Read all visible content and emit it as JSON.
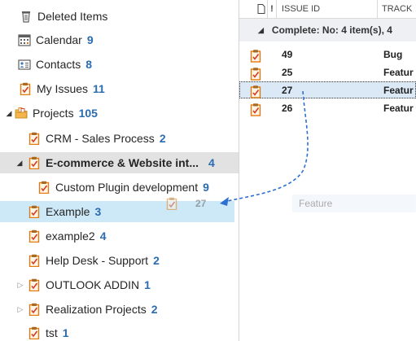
{
  "nav": {
    "items": [
      {
        "label": "Deleted Items",
        "count": "",
        "icon": "trash-icon"
      },
      {
        "label": "Calendar",
        "count": "9",
        "icon": "calendar-icon"
      },
      {
        "label": "Contacts",
        "count": "8",
        "icon": "contacts-icon"
      },
      {
        "label": "My Issues",
        "count": "11",
        "icon": "issue-icon"
      },
      {
        "label": "Projects",
        "count": "105",
        "icon": "projects-folder-icon"
      },
      {
        "label": "CRM - Sales Process",
        "count": "2",
        "icon": "issue-icon"
      },
      {
        "label": "E-commerce & Website int...",
        "count": "4",
        "icon": "issue-icon"
      },
      {
        "label": "Custom Plugin development",
        "count": "9",
        "icon": "issue-icon"
      },
      {
        "label": "Example",
        "count": "3",
        "icon": "issue-icon"
      },
      {
        "label": "example2",
        "count": "4",
        "icon": "issue-icon"
      },
      {
        "label": "Help Desk - Support",
        "count": "2",
        "icon": "issue-icon"
      },
      {
        "label": "OUTLOOK ADDIN",
        "count": "1",
        "icon": "issue-icon"
      },
      {
        "label": "Realization Projects",
        "count": "2",
        "icon": "issue-icon"
      },
      {
        "label": "tst",
        "count": "1",
        "icon": "issue-icon"
      }
    ]
  },
  "grid": {
    "columns": {
      "type_icon": "document-icon",
      "priority": "!",
      "issue_id": "ISSUE ID",
      "tracker": "TRACK"
    },
    "group_label": "Complete: No: 4 item(s), 4",
    "rows": [
      {
        "id": "49",
        "tracker": "Bug"
      },
      {
        "id": "25",
        "tracker": "Featur"
      },
      {
        "id": "27",
        "tracker": "Featur"
      },
      {
        "id": "26",
        "tracker": "Featur"
      }
    ]
  },
  "drag_ghost": {
    "id": "27",
    "tracker": "Feature"
  },
  "colors": {
    "count_blue": "#2b6cb0",
    "drop_target_bg": "#cde8f7",
    "selected_bg": "#e2e2e2",
    "arrow": "#2c6fd1",
    "icon_orange": "#e07a10"
  }
}
